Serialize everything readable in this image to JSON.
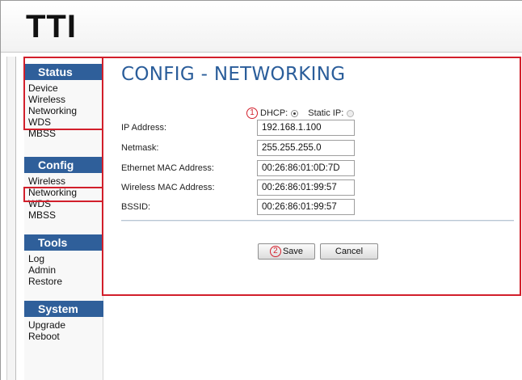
{
  "header": {
    "logo": "TTI"
  },
  "sidebar": {
    "sections": [
      {
        "title": "Status",
        "items": [
          "Device",
          "Wireless",
          "Networking",
          "WDS",
          "MBSS"
        ]
      },
      {
        "title": "Config",
        "items": [
          "Wireless",
          "Networking",
          "WDS",
          "MBSS"
        ]
      },
      {
        "title": "Tools",
        "items": [
          "Log",
          "Admin",
          "Restore"
        ]
      },
      {
        "title": "System",
        "items": [
          "Upgrade",
          "Reboot"
        ]
      }
    ]
  },
  "main": {
    "title": "CONFIG - NETWORKING",
    "ip_mode": {
      "badge": "1",
      "dhcp_label": "DHCP:",
      "static_label": "Static IP:",
      "selected": "DHCP"
    },
    "fields": [
      {
        "label": "IP Address:",
        "value": "192.168.1.100"
      },
      {
        "label": "Netmask:",
        "value": "255.255.255.0"
      },
      {
        "label": "Ethernet MAC Address:",
        "value": "00:26:86:01:0D:7D"
      },
      {
        "label": "Wireless MAC Address:",
        "value": "00:26:86:01:99:57"
      },
      {
        "label": "BSSID:",
        "value": "00:26:86:01:99:57"
      }
    ],
    "save": {
      "badge": "2",
      "label": "Save"
    },
    "cancel": {
      "label": "Cancel"
    }
  },
  "colors": {
    "nav_header": "#2f5f9a",
    "title": "#2a5d9a",
    "annotation": "#d21f2b"
  }
}
